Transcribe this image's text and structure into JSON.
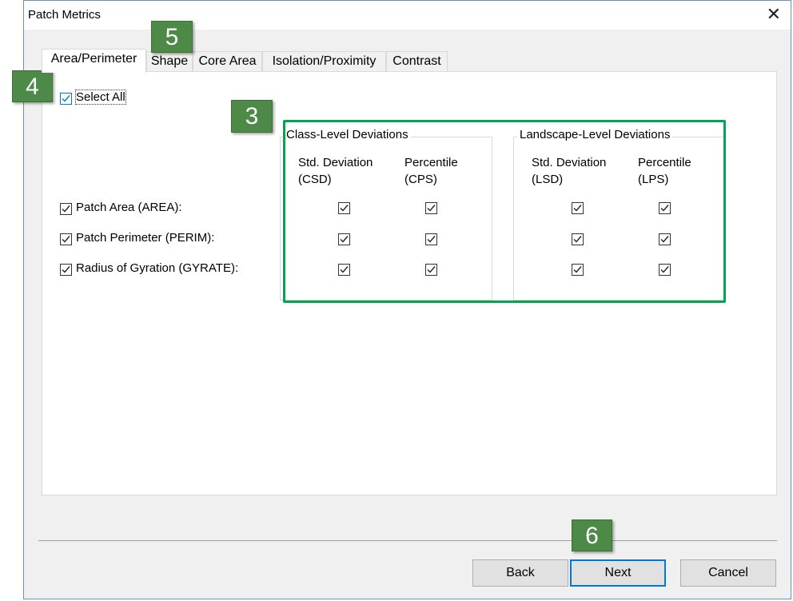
{
  "window": {
    "title": "Patch Metrics",
    "close_glyph": "✕"
  },
  "tabs": [
    "Area/Perimeter",
    "Shape",
    "Core Area",
    "Isolation/Proximity",
    "Contrast"
  ],
  "select_all": {
    "label": "Select All",
    "checked": true
  },
  "metrics": [
    {
      "label": "Patch Area (AREA):",
      "checked": true,
      "csd": true,
      "cps": true,
      "lsd": true,
      "lps": true
    },
    {
      "label": "Patch Perimeter (PERIM):",
      "checked": true,
      "csd": true,
      "cps": true,
      "lsd": true,
      "lps": true
    },
    {
      "label": "Radius of Gyration (GYRATE):",
      "checked": true,
      "csd": true,
      "cps": true,
      "lsd": true,
      "lps": true
    }
  ],
  "class_group": {
    "title": "Class-Level Deviations",
    "col1": {
      "line1": "Std. Deviation",
      "line2": "(CSD)"
    },
    "col2": {
      "line1": "Percentile",
      "line2": "(CPS)"
    }
  },
  "landscape_group": {
    "title": "Landscape-Level Deviations",
    "col1": {
      "line1": "Std. Deviation",
      "line2": "(LSD)"
    },
    "col2": {
      "line1": "Percentile",
      "line2": "(LPS)"
    }
  },
  "callouts": {
    "c3": "3",
    "c4": "4",
    "c5": "5",
    "c6": "6"
  },
  "buttons": {
    "back": "Back",
    "next": "Next",
    "cancel": "Cancel"
  },
  "colors": {
    "callout": "#4d8a48",
    "highlight_frame": "#00a651",
    "focus": "#0078d7"
  }
}
